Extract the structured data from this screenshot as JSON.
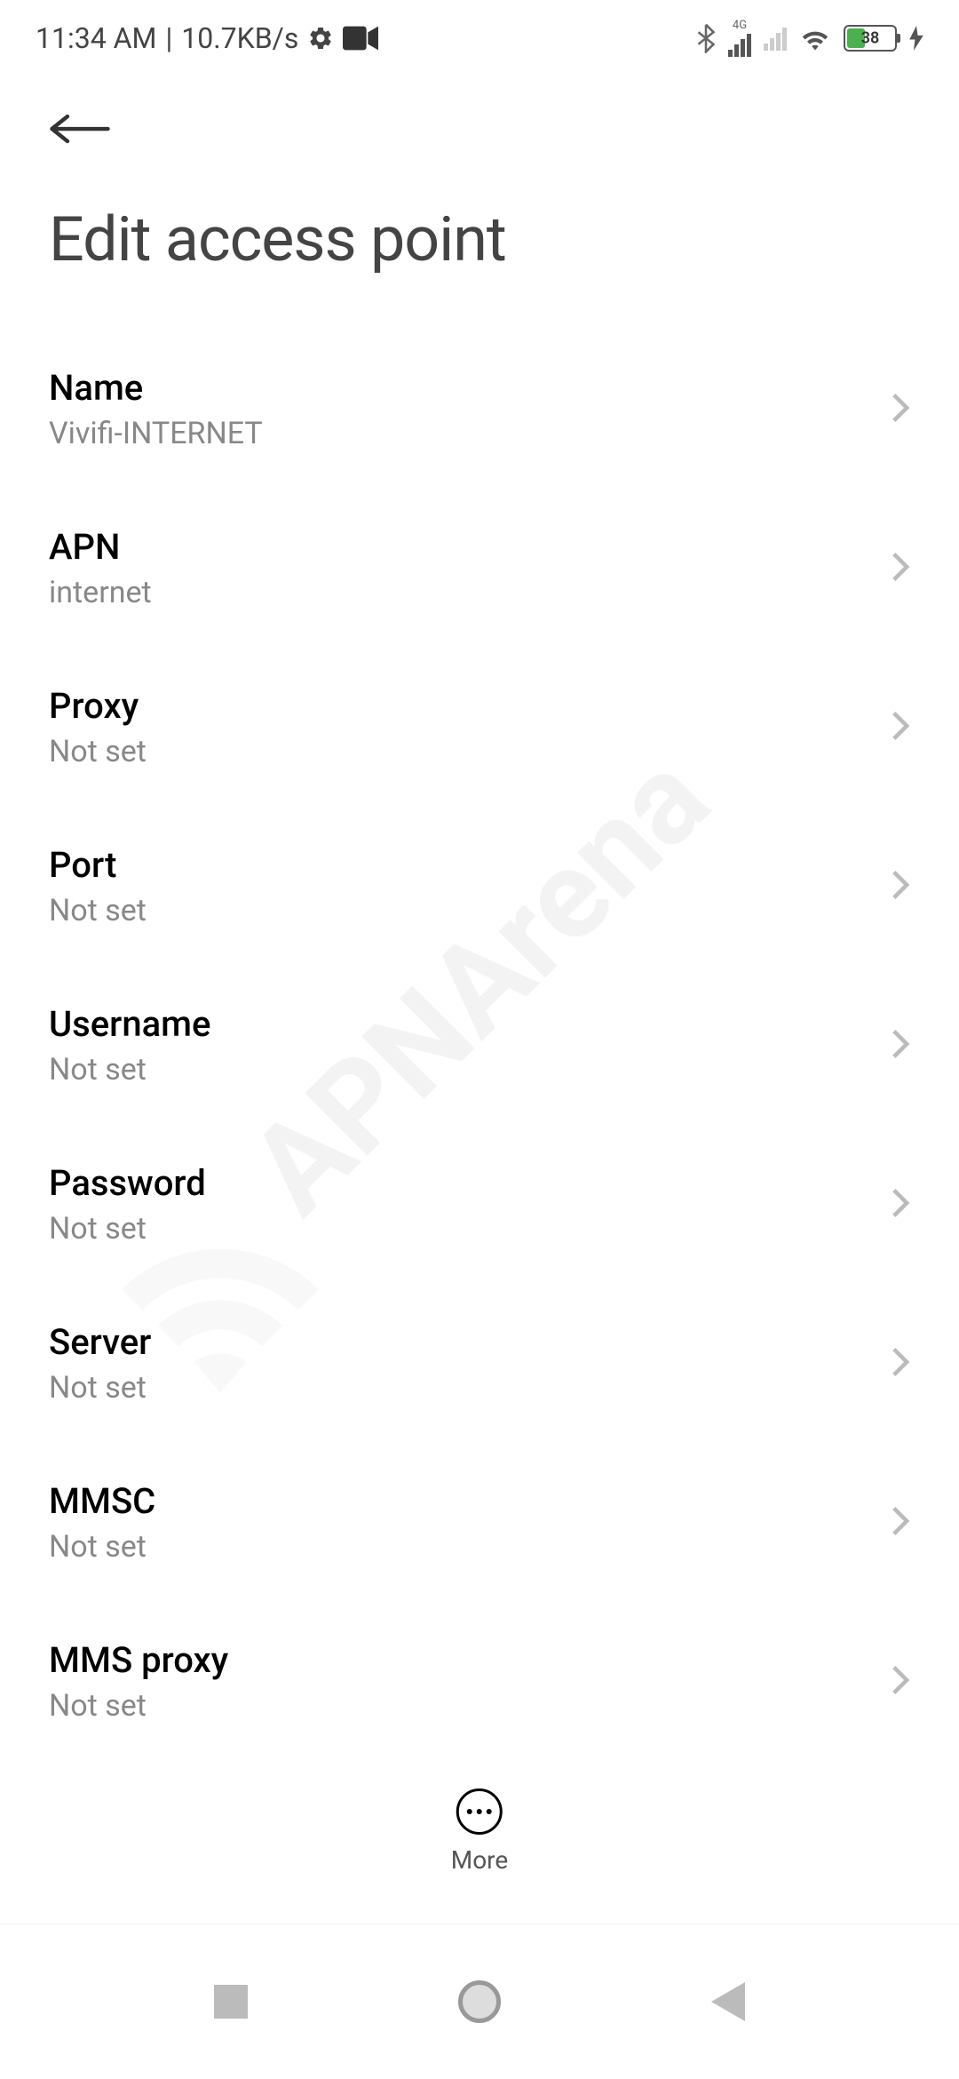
{
  "status_bar": {
    "time": "11:34 AM",
    "data_rate": "10.7KB/s",
    "network_type": "4G",
    "battery_level": "38"
  },
  "page": {
    "title": "Edit access point"
  },
  "settings": [
    {
      "label": "Name",
      "value": "Vivifi-INTERNET"
    },
    {
      "label": "APN",
      "value": "internet"
    },
    {
      "label": "Proxy",
      "value": "Not set"
    },
    {
      "label": "Port",
      "value": "Not set"
    },
    {
      "label": "Username",
      "value": "Not set"
    },
    {
      "label": "Password",
      "value": "Not set"
    },
    {
      "label": "Server",
      "value": "Not set"
    },
    {
      "label": "MMSC",
      "value": "Not set"
    },
    {
      "label": "MMS proxy",
      "value": "Not set"
    }
  ],
  "footer": {
    "more_label": "More"
  },
  "watermark": "APNArena"
}
